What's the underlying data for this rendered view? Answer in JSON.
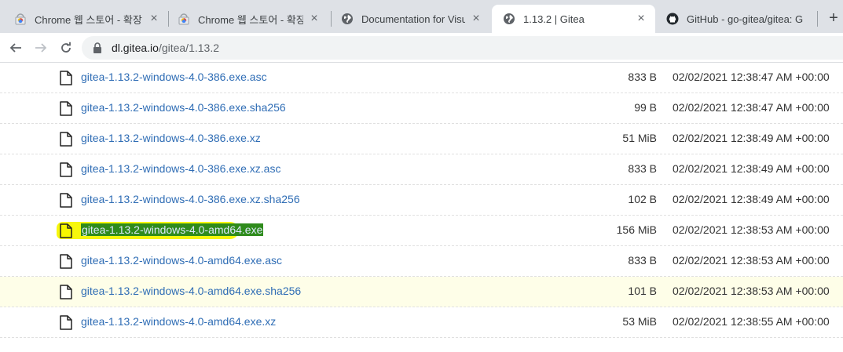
{
  "browser": {
    "tabs": [
      {
        "title": "Chrome 웹 스토어 - 확장",
        "icon": "chrome-web-store-icon",
        "active": false
      },
      {
        "title": "Chrome 웹 스토어 - 확장",
        "icon": "chrome-web-store-icon",
        "active": false
      },
      {
        "title": "Documentation for Visual",
        "icon": "globe-icon",
        "active": false
      },
      {
        "title": "1.13.2 | Gitea",
        "icon": "globe-icon",
        "active": true
      },
      {
        "title": "GitHub - go-gitea/gitea: G",
        "icon": "github-icon",
        "active": false
      }
    ],
    "new_tab": "+",
    "close_glyph": "×",
    "address": {
      "host": "dl.gitea.io",
      "path": "/gitea/1.13.2"
    }
  },
  "files": [
    {
      "name": "gitea-1.13.2-windows-4.0-386.exe.asc",
      "size": "833 B",
      "date": "02/02/2021 12:38:47 AM +00:00"
    },
    {
      "name": "gitea-1.13.2-windows-4.0-386.exe.sha256",
      "size": "99 B",
      "date": "02/02/2021 12:38:47 AM +00:00"
    },
    {
      "name": "gitea-1.13.2-windows-4.0-386.exe.xz",
      "size": "51 MiB",
      "date": "02/02/2021 12:38:49 AM +00:00"
    },
    {
      "name": "gitea-1.13.2-windows-4.0-386.exe.xz.asc",
      "size": "833 B",
      "date": "02/02/2021 12:38:49 AM +00:00"
    },
    {
      "name": "gitea-1.13.2-windows-4.0-386.exe.xz.sha256",
      "size": "102 B",
      "date": "02/02/2021 12:38:49 AM +00:00"
    },
    {
      "name": "gitea-1.13.2-windows-4.0-amd64.exe",
      "size": "156 MiB",
      "date": "02/02/2021 12:38:53 AM +00:00"
    },
    {
      "name": "gitea-1.13.2-windows-4.0-amd64.exe.asc",
      "size": "833 B",
      "date": "02/02/2021 12:38:53 AM +00:00"
    },
    {
      "name": "gitea-1.13.2-windows-4.0-amd64.exe.sha256",
      "size": "101 B",
      "date": "02/02/2021 12:38:53 AM +00:00"
    },
    {
      "name": "gitea-1.13.2-windows-4.0-amd64.exe.xz",
      "size": "53 MiB",
      "date": "02/02/2021 12:38:55 AM +00:00"
    }
  ],
  "annotations": {
    "marked_file_index": 5,
    "hover_row_index": 7
  },
  "colors": {
    "link": "#2f6db5",
    "marker_yellow": "#f7f700",
    "marker_green": "#2f8b1c",
    "hover_row": "#fefee8"
  }
}
